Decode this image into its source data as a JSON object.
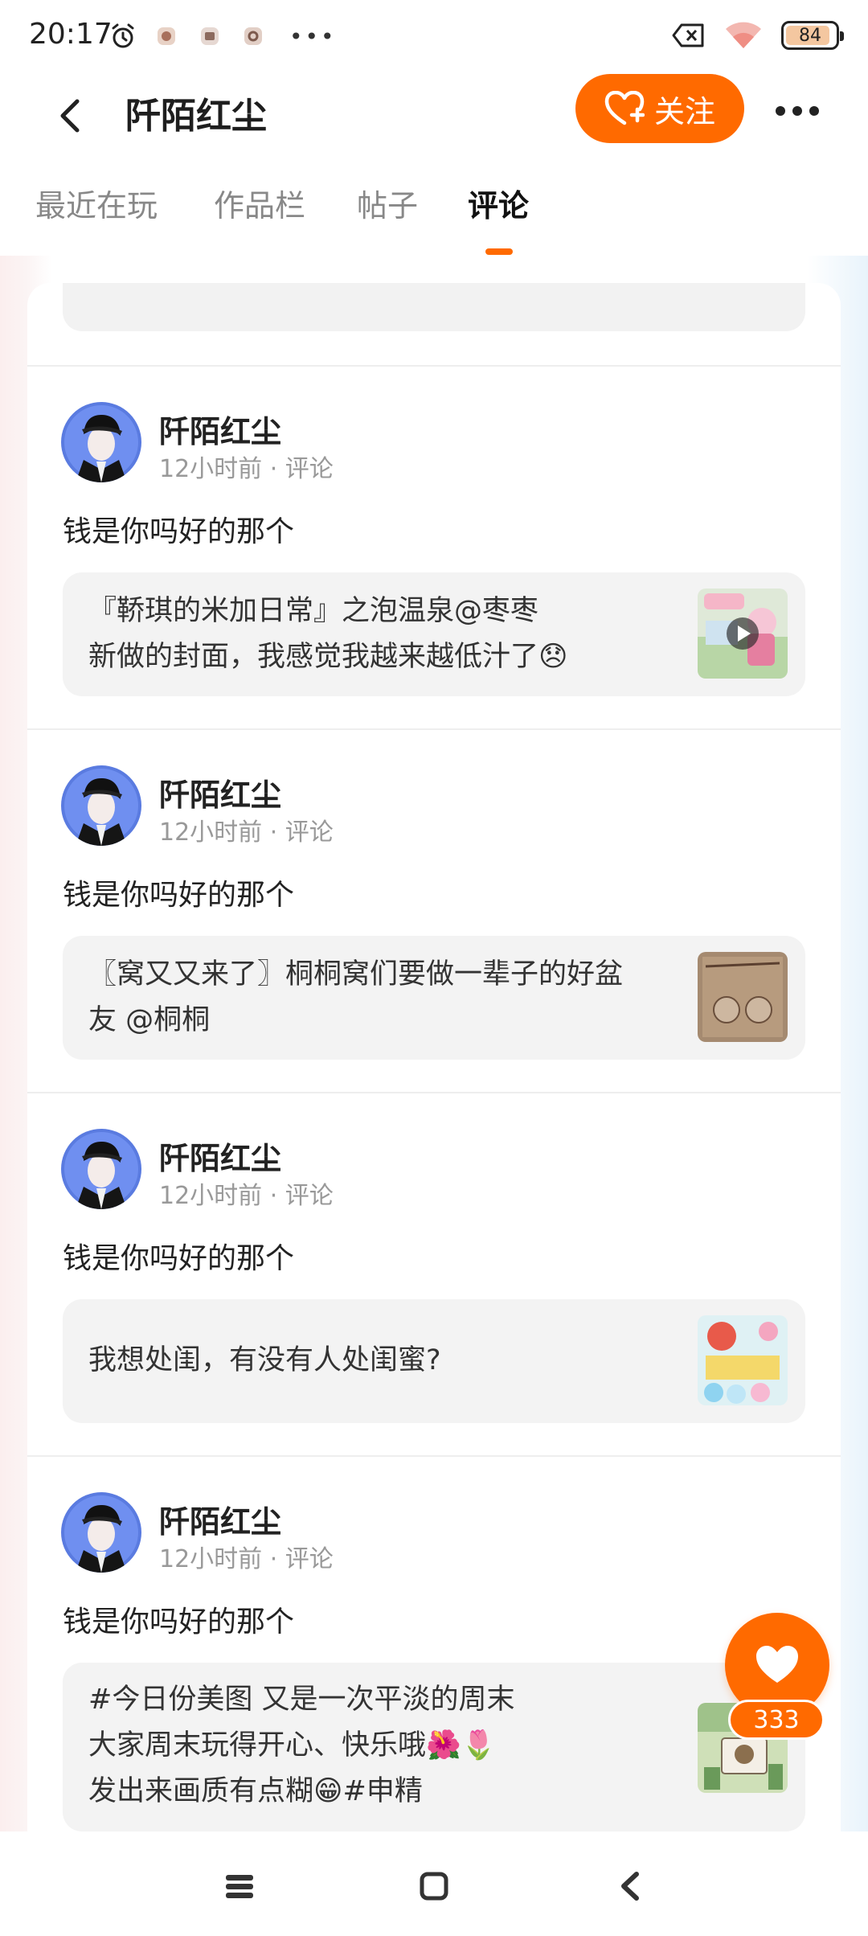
{
  "status_bar": {
    "time": "20:17",
    "battery": "84",
    "icons": [
      "alarm-icon",
      "app-notification-icon",
      "app-notification-icon",
      "app-notification-icon",
      "more-dots-icon",
      "no-sim-icon",
      "wifi-icon",
      "battery-icon"
    ]
  },
  "header": {
    "title": "阡陌红尘",
    "follow_label": "关注",
    "accent_color": "#ff6a00"
  },
  "tabs": [
    {
      "label": "最近在玩",
      "active": false
    },
    {
      "label": "作品栏",
      "active": false
    },
    {
      "label": "帖子",
      "active": false
    },
    {
      "label": "评论",
      "active": true
    }
  ],
  "posts": [
    {
      "author": "阡陌红尘",
      "time": "12小时前",
      "type": "评论",
      "comment": "钱是你吗好的那个",
      "quote_lines": [
        "『鞒琪的米加日常』之泡温泉@枣枣",
        "新做的封面，我感觉我越来越低汁了😞"
      ],
      "thumb_has_play": true
    },
    {
      "author": "阡陌红尘",
      "time": "12小时前",
      "type": "评论",
      "comment": "钱是你吗好的那个",
      "quote_lines": [
        "〖窝又又来了〗桐桐窝们要做一辈子的好盆",
        "友  @桐桐"
      ],
      "thumb_has_play": false
    },
    {
      "author": "阡陌红尘",
      "time": "12小时前",
      "type": "评论",
      "comment": "钱是你吗好的那个",
      "quote_lines": [
        "我想处闺，有没有人处闺蜜?"
      ],
      "thumb_has_play": false
    },
    {
      "author": "阡陌红尘",
      "time": "12小时前",
      "type": "评论",
      "comment": "钱是你吗好的那个",
      "quote_lines": [
        "#今日份美图  又是一次平淡的周末",
        "大家周末玩得开心、快乐哦🌺🌷",
        "发出来画质有点糊😁#申精"
      ],
      "thumb_has_play": false
    }
  ],
  "like": {
    "count": "333"
  },
  "meta_separator": " · "
}
